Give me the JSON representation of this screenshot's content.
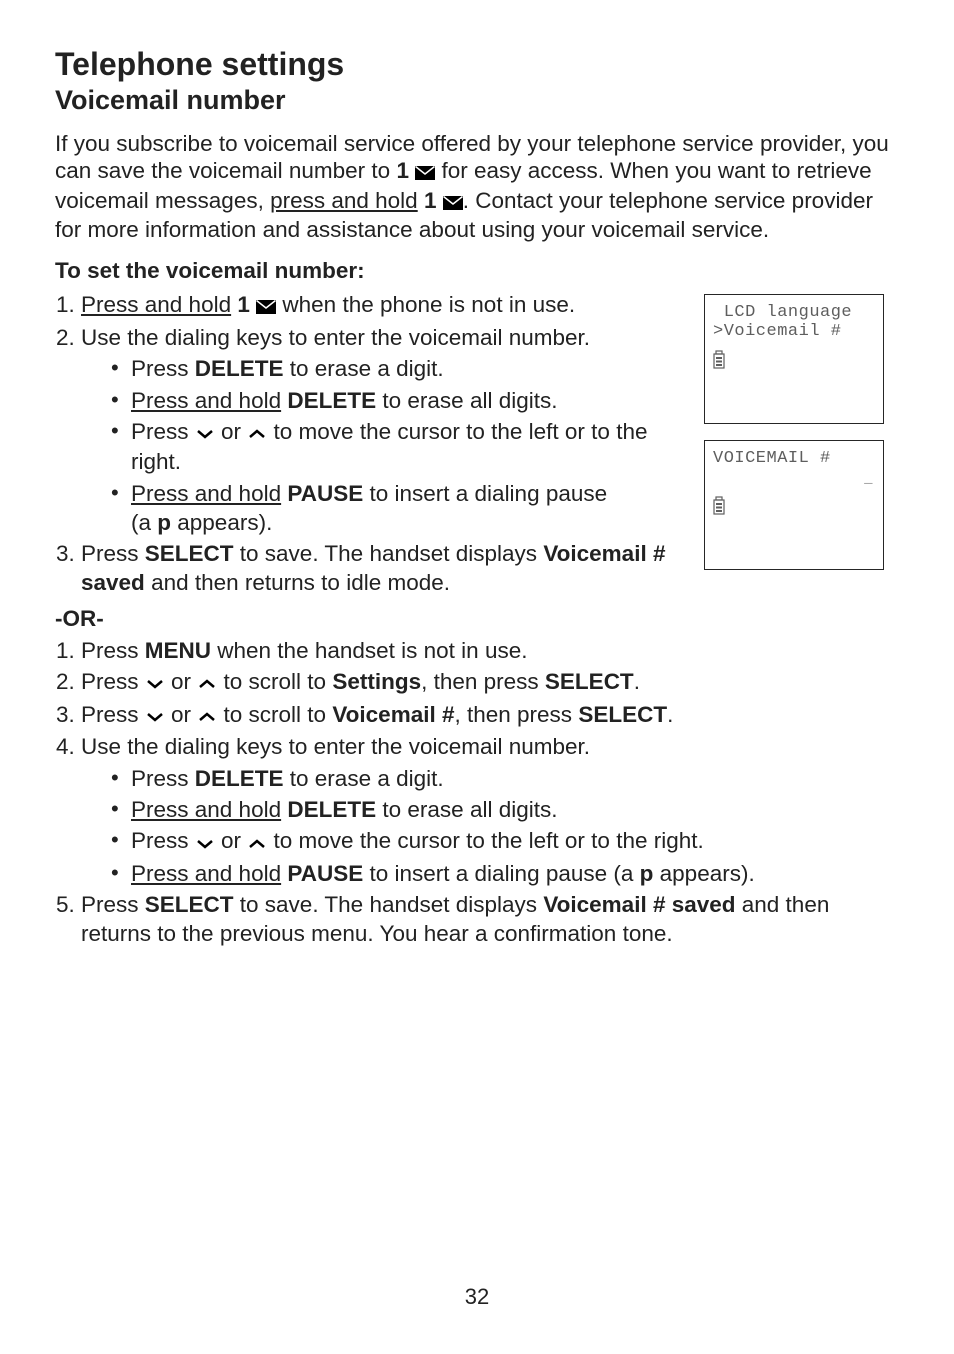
{
  "page_number": "32",
  "heading": "Telephone settings",
  "subheading": "Voicemail number",
  "intro": {
    "seg1": "If you subscribe to voicemail service offered by your telephone service provider, you can save the voicemail number to ",
    "key1": "1",
    "seg2": " for easy access. When you want to retrieve voicemail messages, ",
    "press_hold": "press and hold",
    "key2": "1",
    "seg3": ". Contact your telephone service provider for more information and assistance about using your voicemail service."
  },
  "set_heading": "To set the voicemail number:",
  "method_a": {
    "step1": {
      "pre": "",
      "press_hold": "Press and hold",
      "key": "1",
      "post": " when the phone is not in use."
    },
    "step2": "Use the dialing keys to enter the voicemail number.",
    "bullets": {
      "b1": {
        "pre": "Press ",
        "key": "DELETE",
        "post": " to erase a digit."
      },
      "b2": {
        "press_hold": "Press and hold",
        "key": "DELETE",
        "post": " to erase all digits."
      },
      "b3": {
        "pre": "Press ",
        "post": " to move the cursor to the left or to the right.",
        "or": " or "
      },
      "b4": {
        "press_hold": "Press and hold",
        "key": "PAUSE",
        "mid": " to insert a dialing pause ",
        "paren_open": "(a ",
        "p": "p",
        "paren_close": " appears)."
      }
    },
    "step3": {
      "pre": "Press ",
      "key": "SELECT",
      "mid": " to save. The handset displays ",
      "disp": "Voicemail # saved",
      "post": " and then returns to idle mode."
    }
  },
  "or_label": "-OR-",
  "method_b": {
    "step1": {
      "pre": "Press ",
      "key": "MENU",
      "post": " when the handset is not in use."
    },
    "step2": {
      "pre": "Press ",
      "or": " or ",
      "mid": " to scroll to ",
      "target": "Settings",
      "then": ", then press ",
      "key": "SELECT",
      "end": "."
    },
    "step3": {
      "pre": "Press ",
      "or": " or ",
      "mid": " to scroll to ",
      "target": "Voicemail #",
      "then": ", then press ",
      "key": "SELECT",
      "end": "."
    },
    "step4": "Use the dialing keys to enter the voicemail number.",
    "bullets": {
      "b1": {
        "pre": "Press ",
        "key": "DELETE",
        "post": " to erase a digit."
      },
      "b2": {
        "press_hold": "Press and hold",
        "key": "DELETE",
        "post": " to erase all digits."
      },
      "b3": {
        "pre": "Press ",
        "or": " or ",
        "post": " to move the cursor to the left or to the right."
      },
      "b4": {
        "press_hold": "Press and hold",
        "key": "PAUSE",
        "mid": " to insert a dialing pause (a ",
        "p": "p",
        "post": " appears)."
      }
    },
    "step5": {
      "pre": "Press ",
      "key": "SELECT",
      "mid": " to save. The handset displays ",
      "disp": "Voicemail # saved",
      "post": " and then returns to the previous menu. You hear a confirmation tone."
    }
  },
  "lcd1": {
    "line1": " LCD language",
    "line2": ">Voicemail #"
  },
  "lcd2": {
    "line1": "VOICEMAIL #",
    "cursor": "_"
  }
}
